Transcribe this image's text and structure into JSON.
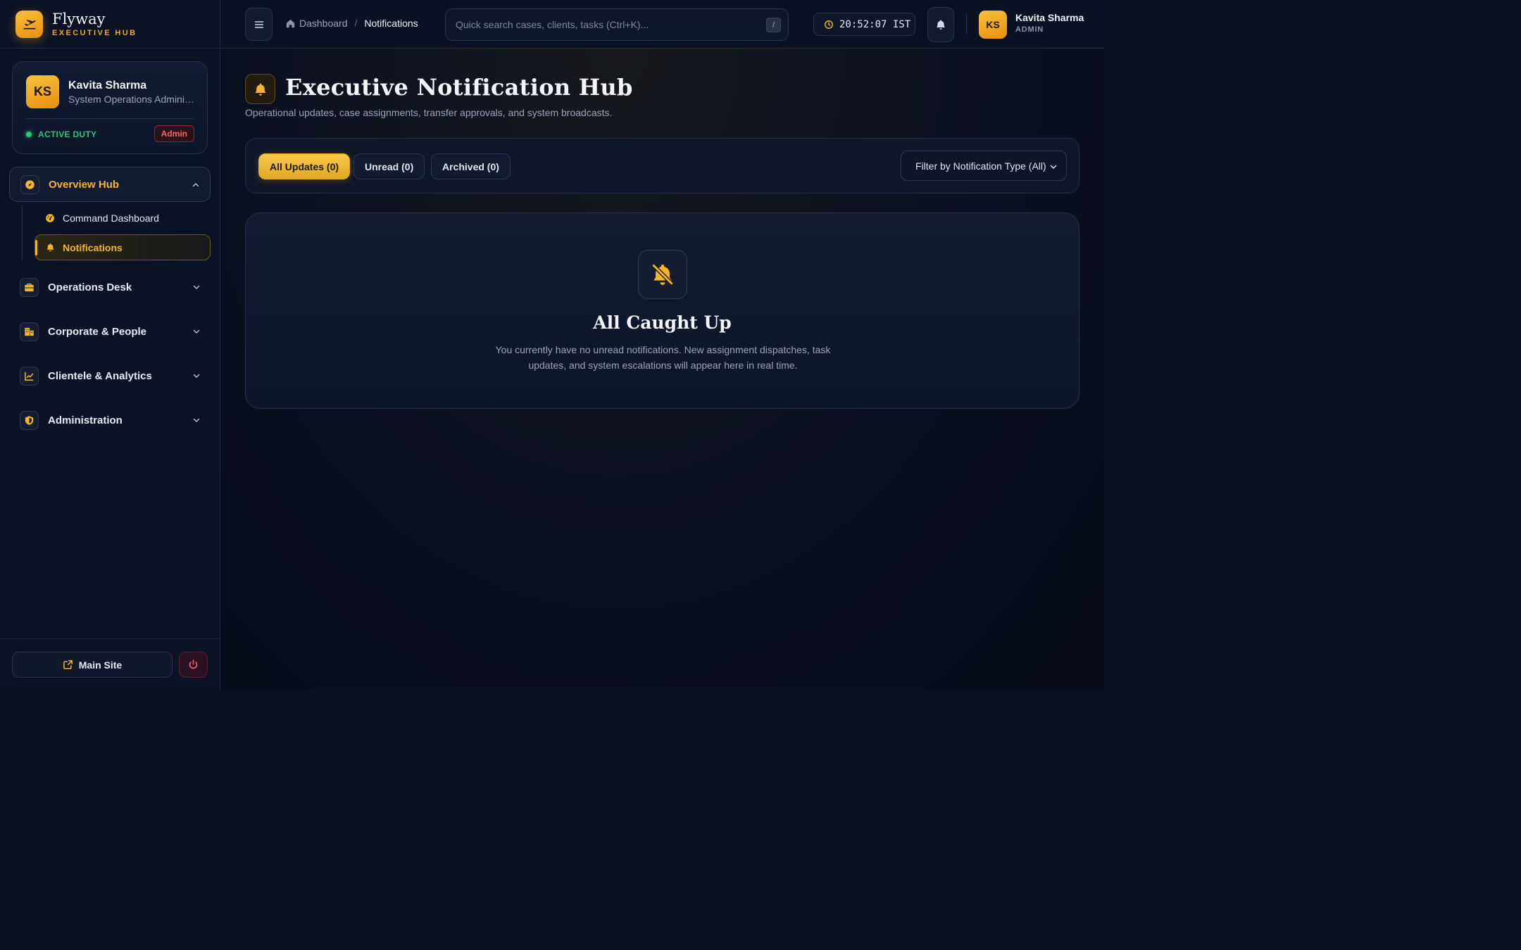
{
  "brand": {
    "name": "Flyway",
    "subtitle": "EXECUTIVE HUB"
  },
  "profile": {
    "initials": "KS",
    "name": "Kavita Sharma",
    "role": "System Operations Administrator",
    "status": "ACTIVE DUTY",
    "badge": "Admin"
  },
  "nav": {
    "groups": [
      {
        "label": "Overview Hub",
        "icon": "compass-icon",
        "expanded": true
      },
      {
        "label": "Operations Desk",
        "icon": "briefcase-icon"
      },
      {
        "label": "Corporate & People",
        "icon": "building-icon"
      },
      {
        "label": "Clientele & Analytics",
        "icon": "chart-line-icon"
      },
      {
        "label": "Administration",
        "icon": "shield-icon"
      }
    ],
    "sub_items": [
      {
        "label": "Command Dashboard",
        "icon": "gauge-icon"
      },
      {
        "label": "Notifications",
        "icon": "bell-icon",
        "active": true
      }
    ]
  },
  "footer": {
    "main_site_label": "Main Site"
  },
  "topbar": {
    "breadcrumb": {
      "home": "Dashboard",
      "separator": "/",
      "current": "Notifications"
    },
    "search_placeholder": "Quick search cases, clients, tasks (Ctrl+K)...",
    "search_shortcut": "/",
    "clock": "20:52:07 IST",
    "user_initials": "KS",
    "user_name": "Kavita Sharma",
    "user_role": "ADMIN"
  },
  "page": {
    "title": "Executive Notification Hub",
    "subtitle": "Operational updates, case assignments, transfer approvals, and system broadcasts.",
    "tabs": [
      {
        "label": "All Updates (0)",
        "active": true
      },
      {
        "label": "Unread (0)"
      },
      {
        "label": "Archived (0)"
      }
    ],
    "type_filter": "Filter by Notification Type (All)",
    "empty": {
      "title": "All Caught Up",
      "text": "You currently have no unread notifications. New assignment dispatches, task updates, and system escalations will appear here in real time."
    }
  },
  "colors": {
    "accent": "#f5b52a",
    "background": "#0a1020",
    "success": "#2fc47a",
    "danger": "#f06a6a"
  }
}
